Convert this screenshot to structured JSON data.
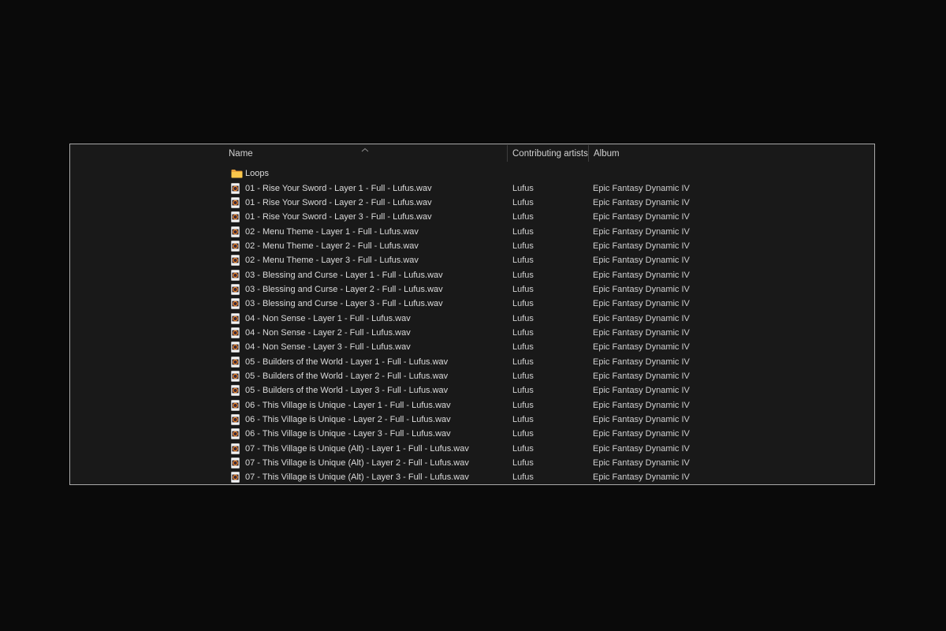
{
  "window": {
    "kind": "file-explorer-list-view",
    "outside_background": "#0a0a0a",
    "background": "#191919",
    "border_color": "#a9a9a9"
  },
  "columns": {
    "name": "Name",
    "artists": "Contributing artists",
    "album": "Album"
  },
  "sort": {
    "column": "Name",
    "direction": "ascending",
    "indicator_icon": "chevron-up-icon"
  },
  "icons": {
    "folder": "folder-icon",
    "audio_file": "audio-file-icon",
    "folder_color_back": "#e9a23b",
    "folder_color_front": "#f9c74b",
    "audio_ring_color": "#df7f2e"
  },
  "text_colors": {
    "header": "#d2d2d2",
    "file_name": "#dbdbdb",
    "secondary": "#d0d0d0"
  },
  "rows": [
    {
      "type": "folder",
      "name": "Loops",
      "artist": "",
      "album": ""
    },
    {
      "type": "audio",
      "name": "01 - Rise Your Sword - Layer 1 - Full - Lufus.wav",
      "artist": "Lufus",
      "album": "Epic Fantasy Dynamic IV"
    },
    {
      "type": "audio",
      "name": "01 - Rise Your Sword - Layer 2 - Full - Lufus.wav",
      "artist": "Lufus",
      "album": "Epic Fantasy Dynamic IV"
    },
    {
      "type": "audio",
      "name": "01 - Rise Your Sword - Layer 3 - Full - Lufus.wav",
      "artist": "Lufus",
      "album": "Epic Fantasy Dynamic IV"
    },
    {
      "type": "audio",
      "name": "02 - Menu Theme - Layer 1 - Full - Lufus.wav",
      "artist": "Lufus",
      "album": "Epic Fantasy Dynamic IV"
    },
    {
      "type": "audio",
      "name": "02 - Menu Theme - Layer 2 - Full - Lufus.wav",
      "artist": "Lufus",
      "album": "Epic Fantasy Dynamic IV"
    },
    {
      "type": "audio",
      "name": "02 - Menu Theme - Layer 3 - Full - Lufus.wav",
      "artist": "Lufus",
      "album": "Epic Fantasy Dynamic IV"
    },
    {
      "type": "audio",
      "name": "03 - Blessing and Curse - Layer 1 - Full - Lufus.wav",
      "artist": "Lufus",
      "album": "Epic Fantasy Dynamic IV"
    },
    {
      "type": "audio",
      "name": "03 - Blessing and Curse - Layer 2 - Full - Lufus.wav",
      "artist": "Lufus",
      "album": "Epic Fantasy Dynamic IV"
    },
    {
      "type": "audio",
      "name": "03 - Blessing and Curse - Layer 3 - Full - Lufus.wav",
      "artist": "Lufus",
      "album": "Epic Fantasy Dynamic IV"
    },
    {
      "type": "audio",
      "name": "04 - Non Sense - Layer 1 - Full - Lufus.wav",
      "artist": "Lufus",
      "album": "Epic Fantasy Dynamic IV"
    },
    {
      "type": "audio",
      "name": "04 - Non Sense - Layer 2 - Full - Lufus.wav",
      "artist": "Lufus",
      "album": "Epic Fantasy Dynamic IV"
    },
    {
      "type": "audio",
      "name": "04 - Non Sense - Layer 3 - Full - Lufus.wav",
      "artist": "Lufus",
      "album": "Epic Fantasy Dynamic IV"
    },
    {
      "type": "audio",
      "name": "05 - Builders of the World - Layer 1 - Full - Lufus.wav",
      "artist": "Lufus",
      "album": "Epic Fantasy Dynamic IV"
    },
    {
      "type": "audio",
      "name": "05 - Builders of the World - Layer 2 - Full - Lufus.wav",
      "artist": "Lufus",
      "album": "Epic Fantasy Dynamic IV"
    },
    {
      "type": "audio",
      "name": "05 - Builders of the World - Layer 3 - Full - Lufus.wav",
      "artist": "Lufus",
      "album": "Epic Fantasy Dynamic IV"
    },
    {
      "type": "audio",
      "name": "06 - This Village is Unique - Layer 1 - Full - Lufus.wav",
      "artist": "Lufus",
      "album": "Epic Fantasy Dynamic IV"
    },
    {
      "type": "audio",
      "name": "06 - This Village is Unique - Layer 2 - Full - Lufus.wav",
      "artist": "Lufus",
      "album": "Epic Fantasy Dynamic IV"
    },
    {
      "type": "audio",
      "name": "06 - This Village is Unique - Layer 3 - Full - Lufus.wav",
      "artist": "Lufus",
      "album": "Epic Fantasy Dynamic IV"
    },
    {
      "type": "audio",
      "name": "07 - This Village is Unique (Alt) - Layer 1 - Full - Lufus.wav",
      "artist": "Lufus",
      "album": "Epic Fantasy Dynamic IV"
    },
    {
      "type": "audio",
      "name": "07 - This Village is Unique (Alt) - Layer 2 - Full - Lufus.wav",
      "artist": "Lufus",
      "album": "Epic Fantasy Dynamic IV"
    },
    {
      "type": "audio",
      "name": "07 - This Village is Unique (Alt) - Layer 3 - Full - Lufus.wav",
      "artist": "Lufus",
      "album": "Epic Fantasy Dynamic IV"
    }
  ]
}
